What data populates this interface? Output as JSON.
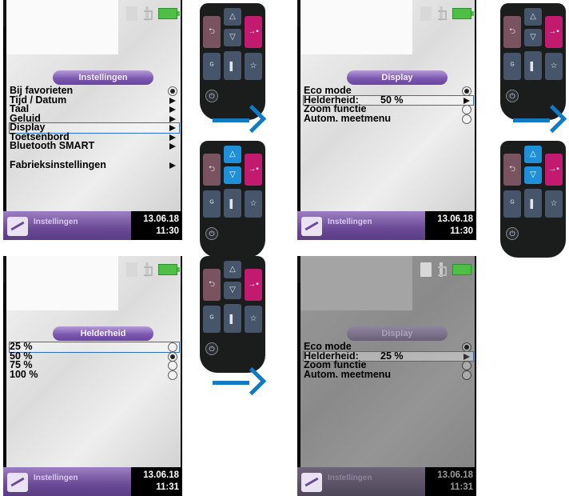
{
  "common": {
    "footer_tab": "Instellingen",
    "date": "13.06.18",
    "icons": [
      "sd-card-icon",
      "bluetooth-icon",
      "battery-icon"
    ],
    "keys": {
      "back": "⮌",
      "up": "△",
      "down": "▽",
      "enter": "→▪",
      "measure": "ᴳ",
      "mid": "▌",
      "favorite": "☆",
      "power": "⏻"
    },
    "colors": {
      "selection": "#2d6fbf",
      "header": "#7c58b1",
      "accent_key": "#c11a6f",
      "active_key": "#1f8fd8",
      "arrow": "#1379c2"
    }
  },
  "screen1": {
    "header": "Instellingen",
    "items": [
      {
        "label": "Bij favorieten"
      },
      {
        "label": "Tijd / Datum"
      },
      {
        "label": "Taal"
      },
      {
        "label": "Geluid"
      },
      {
        "label": "Display"
      },
      {
        "label": "Toetsenbord"
      },
      {
        "label": "Bluetooth SMART"
      },
      {
        "label": "Fabrieksinstellingen"
      }
    ],
    "selected": "Display",
    "time": "11:30"
  },
  "screen2": {
    "header": "Display",
    "items": [
      {
        "label": "Eco mode"
      },
      {
        "label": "Helderheid:",
        "value": "50 %"
      },
      {
        "label": "Zoom functie"
      },
      {
        "label": "Autom. meetmenu"
      }
    ],
    "selected": "Helderheid:",
    "time": "11:30"
  },
  "screen3": {
    "header": "Helderheid",
    "items": [
      {
        "label": "25 %"
      },
      {
        "label": "50 %"
      },
      {
        "label": "75 %"
      },
      {
        "label": "100 %"
      }
    ],
    "selected": "25 %",
    "checked": "50 %",
    "time": "11:31"
  },
  "screen4": {
    "header": "Display",
    "items": [
      {
        "label": "Eco mode"
      },
      {
        "label": "Helderheid:",
        "value": "25 %"
      },
      {
        "label": "Zoom functie"
      },
      {
        "label": "Autom. meetmenu"
      }
    ],
    "selected": "Helderheid:",
    "time": "11:31"
  }
}
